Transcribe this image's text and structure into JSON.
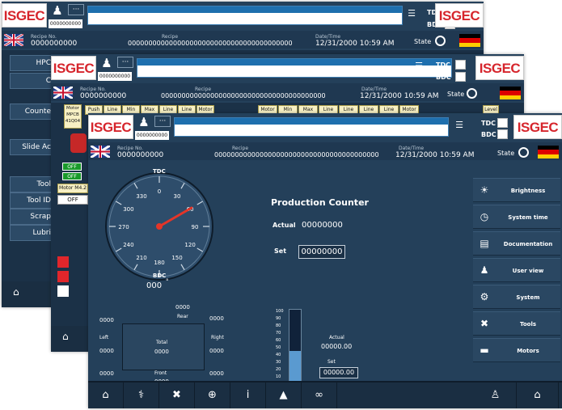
{
  "header": {
    "logo_text": "ISGEC",
    "user_id": "0000000000",
    "more_label": "···",
    "menu_icon": "☰",
    "tdc_label": "TDC",
    "bdc_label": "BDC",
    "recipe_no_label": "Recipe No.",
    "recipe_no_value": "0000000000",
    "recipe_label": "Recipe",
    "recipe_value": "0000000000000000000000000000000000000000",
    "datetime_label": "Date/Time",
    "datetime_value": "12/31/2000 10:59 AM",
    "state_label": "State"
  },
  "window1": {
    "side_buttons": [
      "HPC",
      "C",
      "Counte",
      "Slide Ac",
      "Tool",
      "Tool ID",
      "Scrap",
      "Lubri"
    ]
  },
  "window2": {
    "motor_box": "Motor MPCB 41Q04",
    "header_boxes_a": [
      "Push",
      "Line",
      "Min",
      "Max",
      "Line",
      "Line",
      "Motor"
    ],
    "header_boxes_b": [
      "Motor",
      "Min",
      "Max",
      "Line",
      "Line",
      "Line",
      "Line",
      "Motor"
    ],
    "level_label": "Level",
    "off1": "OFF",
    "off2": "OFF",
    "motor_m42": "Motor M4.2",
    "off3": "OFF"
  },
  "gauge": {
    "tdc_label": "TDC",
    "bdc_label": "BDC",
    "ticks": [
      "0",
      "30",
      "60",
      "90",
      "120",
      "150",
      "180",
      "210",
      "240",
      "270",
      "300",
      "330"
    ],
    "angle_degrees": 60,
    "angle_value": "000",
    "angle_unit": "°"
  },
  "counter": {
    "title": "Production Counter",
    "actual_label": "Actual",
    "actual_value": "00000000",
    "set_label": "Set",
    "set_value": "00000000"
  },
  "tonnage": {
    "rear_value": "0000",
    "rear_label": "Rear",
    "rear_left_value": "0000",
    "rear_right_value": "0000",
    "left_label": "Left",
    "left_value": "0000",
    "right_label": "Right",
    "right_value": "0000",
    "total_label": "Total",
    "total_value": "0000",
    "front_label": "Front",
    "front_value": "0000",
    "front_left_value": "0000",
    "front_right_value": "0000"
  },
  "scale": {
    "ticks": [
      "100",
      "90",
      "80",
      "70",
      "60",
      "50",
      "40",
      "30",
      "20",
      "10"
    ],
    "fill_fraction": 0.45,
    "actual_label": "Actual",
    "actual_value": "00000.00",
    "set_label": "Set",
    "set_value": "00000.00"
  },
  "side_menu": [
    {
      "label": "Brightness",
      "icon": "brightness-icon"
    },
    {
      "label": "System time",
      "icon": "clock-icon"
    },
    {
      "label": "Documentation",
      "icon": "document-icon"
    },
    {
      "label": "User view",
      "icon": "user-icon"
    },
    {
      "label": "System",
      "icon": "gear-icon"
    },
    {
      "label": "Tools",
      "icon": "tools-icon"
    },
    {
      "label": "Motors",
      "icon": "motor-icon"
    }
  ],
  "footer": [
    {
      "icon": "home-machine-icon",
      "glyph": "⌂"
    },
    {
      "icon": "stethoscope-icon",
      "glyph": "⚕"
    },
    {
      "icon": "tools-icon",
      "glyph": "✖"
    },
    {
      "icon": "globe-icon",
      "glyph": "⊕"
    },
    {
      "icon": "info-icon",
      "glyph": "i"
    },
    {
      "icon": "edit-icon",
      "glyph": "▲"
    },
    {
      "icon": "glasses-icon",
      "glyph": "∞"
    },
    {
      "icon": "user-icon",
      "glyph": "♙"
    },
    {
      "icon": "home-icon",
      "glyph": "⌂"
    }
  ],
  "colors": {
    "panel": "#24405a",
    "logo_red": "#d6252c",
    "gauge_needle": "#e53528",
    "scale_fill": "#5a9ad0"
  }
}
